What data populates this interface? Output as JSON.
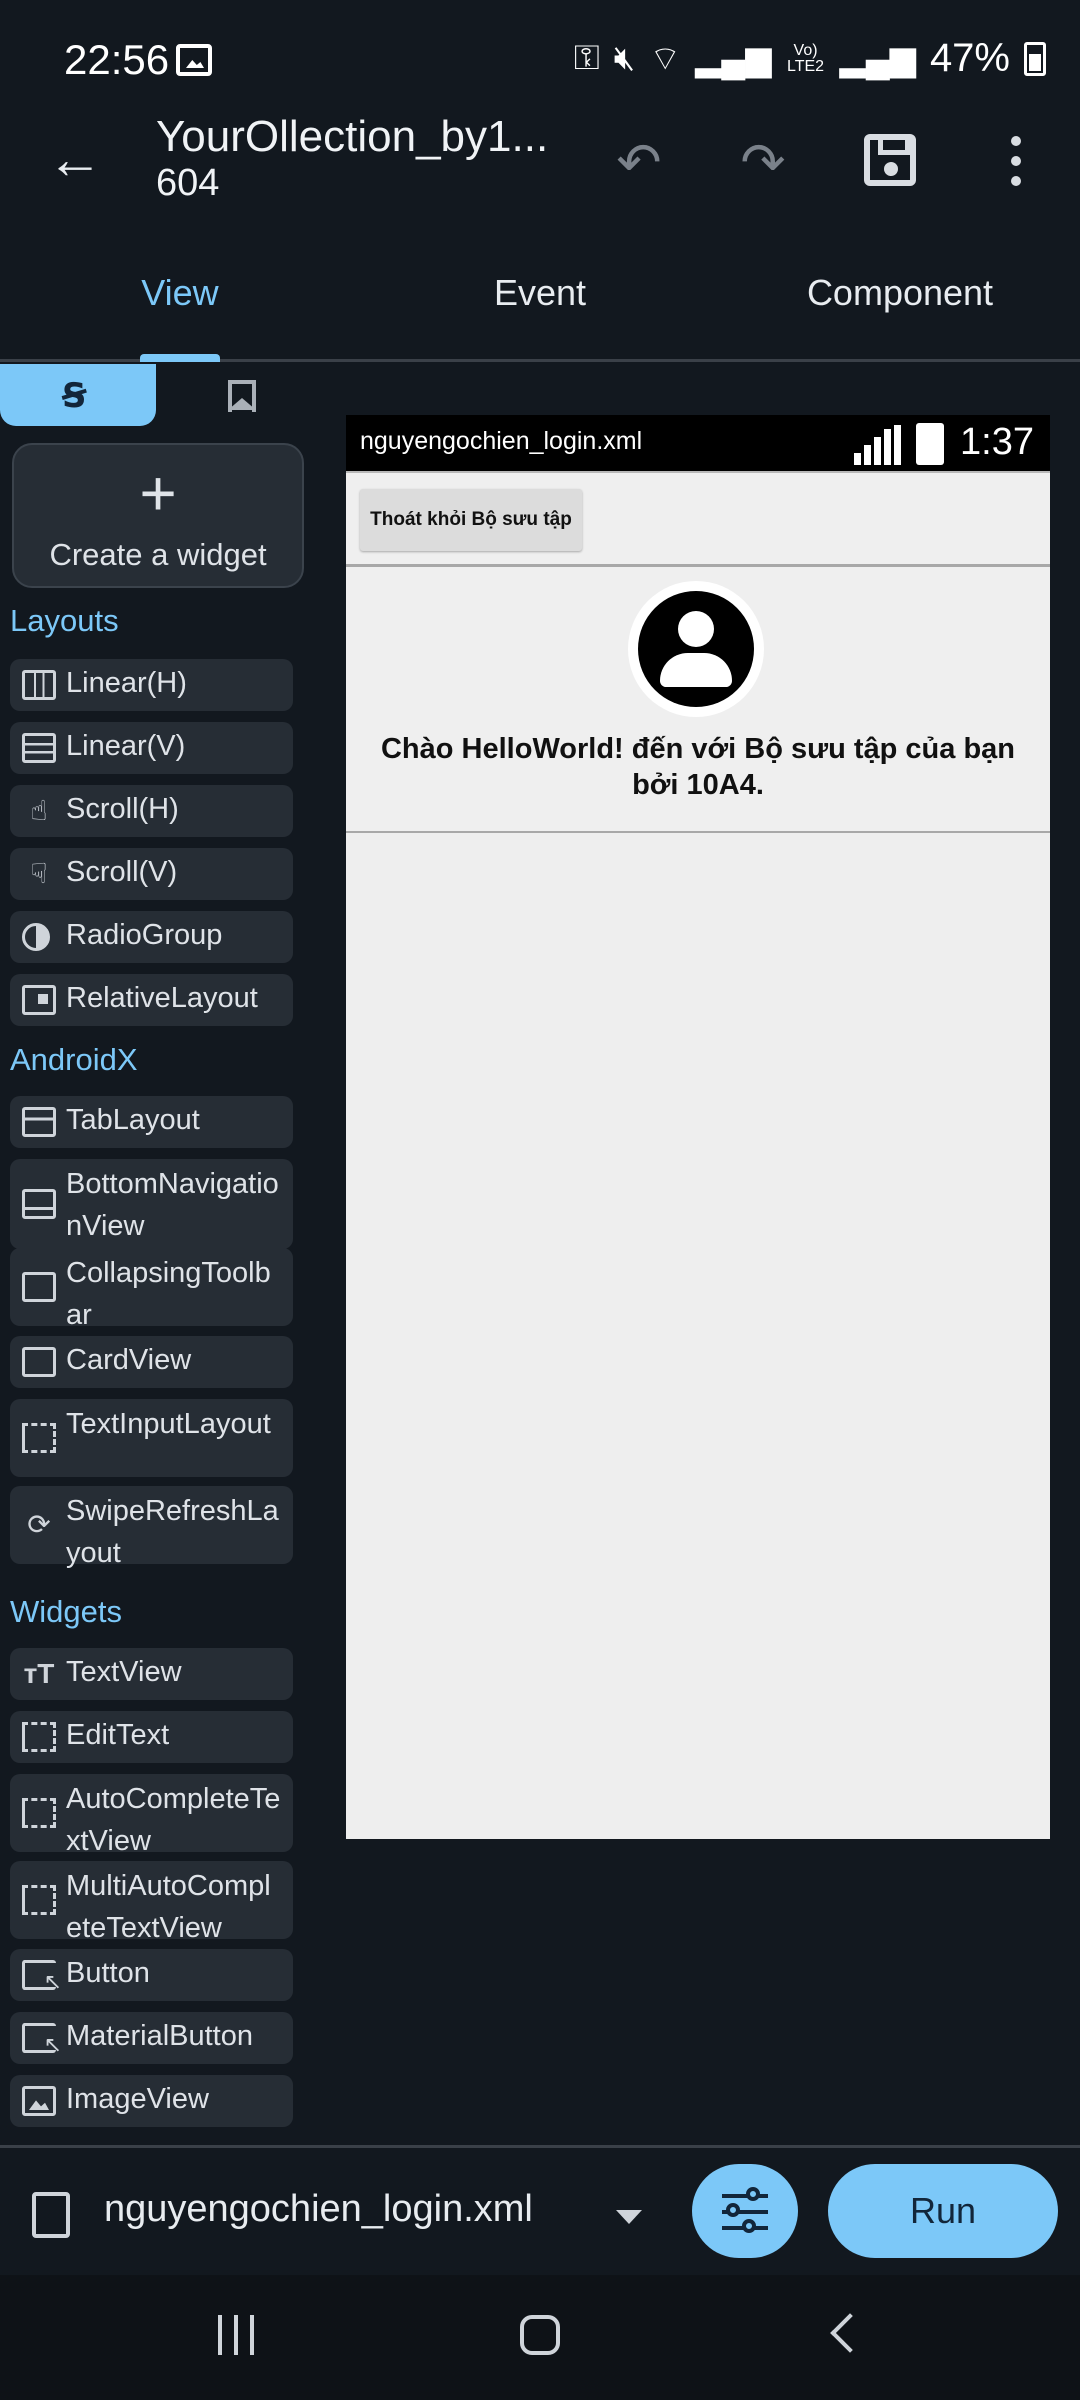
{
  "status_bar": {
    "time": "22:56",
    "battery": "47%",
    "network": "Vo) LTE2"
  },
  "toolbar": {
    "title": "YourOllection_by1...",
    "subtitle": "604"
  },
  "tabs": [
    {
      "label": "View",
      "active": true
    },
    {
      "label": "Event",
      "active": false
    },
    {
      "label": "Component",
      "active": false
    }
  ],
  "palette": {
    "create_widget": "Create a widget",
    "sections": [
      {
        "title": "Layouts",
        "items": [
          "Linear(H)",
          "Linear(V)",
          "Scroll(H)",
          "Scroll(V)",
          "RadioGroup",
          "RelativeLayout"
        ]
      },
      {
        "title": "AndroidX",
        "items": [
          "TabLayout",
          "BottomNavigationView",
          "CollapsingToolbar",
          "CardView",
          "TextInputLayout",
          "SwipeRefreshLayout"
        ]
      },
      {
        "title": "Widgets",
        "items": [
          "TextView",
          "EditText",
          "AutoCompleteTextView",
          "MultiAutoCompleteTextView",
          "Button",
          "MaterialButton",
          "ImageView"
        ]
      }
    ]
  },
  "preview": {
    "file_name": "nguyengochien_login.xml",
    "time": "1:37",
    "exit_button": "Thoát khỏi Bộ sưu tập",
    "welcome_text": "Chào HelloWorld! đến với Bộ sưu tập của bạn bởi 10A4."
  },
  "bottom_bar": {
    "file_select": "nguyengochien_login.xml",
    "run_label": "Run"
  },
  "colors": {
    "accent": "#7cc8f8",
    "background": "#12181f",
    "item_bg": "#262d35"
  }
}
